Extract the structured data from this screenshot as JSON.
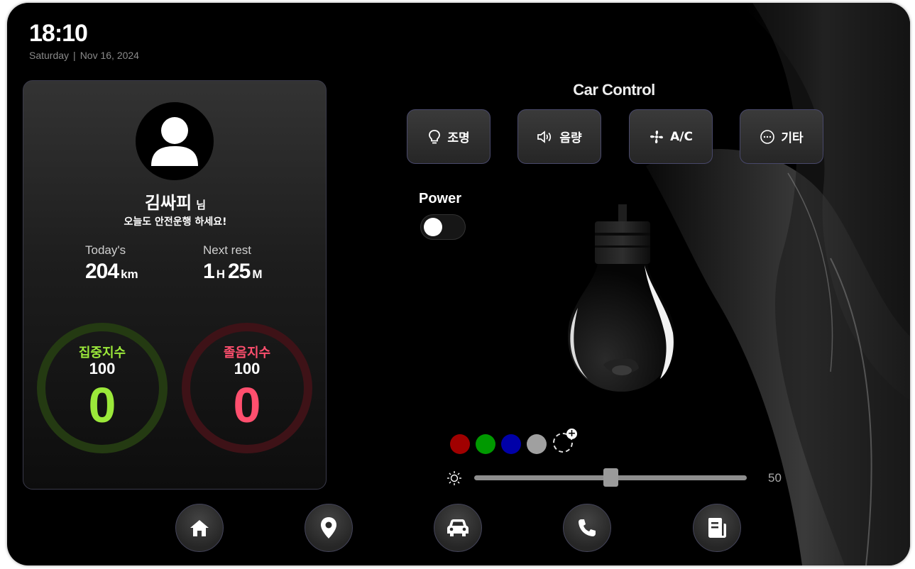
{
  "status": {
    "time": "18:10",
    "day": "Saturday",
    "separator": "|",
    "date": "Nov 16, 2024"
  },
  "profile": {
    "avatar_icon": "user-icon",
    "name": "김싸피",
    "honorific": "님",
    "greeting": "오늘도 안전운행 하세요!",
    "today_label": "Today's",
    "today_value": "204",
    "today_unit": "km",
    "next_rest_label": "Next rest",
    "rest_hours": "1",
    "rest_h_unit": "H",
    "rest_minutes": "25",
    "rest_m_unit": "M"
  },
  "gauges": [
    {
      "title": "집중지수",
      "max": "100",
      "value": "0",
      "color": "#9be83a",
      "ring_color": "#243a12"
    },
    {
      "title": "졸음지수",
      "max": "100",
      "value": "0",
      "color": "#ff4f6e",
      "ring_color": "#3e1217"
    }
  ],
  "car_control": {
    "title": "Car Control",
    "buttons": [
      {
        "label": "조명",
        "icon": "lightbulb-icon"
      },
      {
        "label": "음량",
        "icon": "speaker-icon"
      },
      {
        "label": "A/C",
        "icon": "fan-icon"
      },
      {
        "label": "기타",
        "icon": "more-icon"
      }
    ]
  },
  "lighting": {
    "power_label": "Power",
    "power_on": false,
    "swatches": [
      "#a00000",
      "#009900",
      "#0000a8",
      "#a0a0a0"
    ],
    "brightness_icon": "sun-icon",
    "brightness": 50,
    "brightness_text": "50"
  },
  "nav": [
    {
      "name": "home",
      "icon": "home-icon"
    },
    {
      "name": "location",
      "icon": "location-pin-icon"
    },
    {
      "name": "car",
      "icon": "car-icon"
    },
    {
      "name": "phone",
      "icon": "phone-icon"
    },
    {
      "name": "document",
      "icon": "document-icon"
    }
  ]
}
